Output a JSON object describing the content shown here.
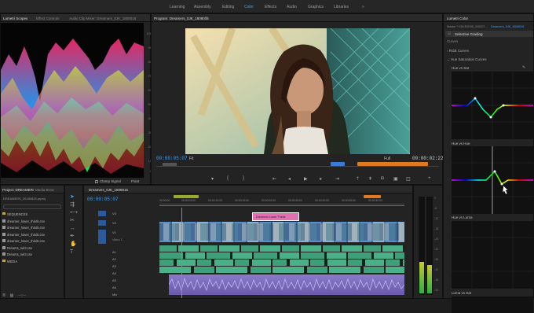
{
  "workspaces": [
    "Learning",
    "Assembly",
    "Editing",
    "Color",
    "Effects",
    "Audio",
    "Graphics",
    "Libraries"
  ],
  "workspace_active": "Color",
  "workspace_more": "»",
  "scopes_panel": {
    "tabs": [
      "Lumetri Scopes",
      "Effect Controls",
      "Audio Clip Mixer: Dreamers_0JK_1808015"
    ],
    "active": "Lumetri Scopes",
    "y_ticks": [
      "100",
      "90",
      "80",
      "70",
      "60",
      "50",
      "40",
      "30",
      "20",
      "10",
      "0"
    ],
    "bottom_check": "Clamp Signal",
    "bottom_value": "Float"
  },
  "program_monitor": {
    "title": "Program: Dreamers_0JK_1808015",
    "timecode_left": "00:00:05:07",
    "fit": "Fit",
    "full": "Full",
    "timecode_right": "00:00:02:22",
    "marker_blue": "",
    "marker_orange": ""
  },
  "lumetri_color": {
    "title": "Lumetri Color",
    "master": "Master * KDLR2095_200027...",
    "clip": "Dreamers_0JK_1808015",
    "preset": "Selective Grading",
    "curves_label": "Curves",
    "rgb_curves": "RGB Curves",
    "hue_sat_curves": "Hue Saturation Curves",
    "curve_titles": [
      "Hue vs Sat",
      "Hue vs Hue",
      "Hue vs Luma",
      "Luma vs Sat"
    ]
  },
  "project_panel": {
    "tabs": [
      "Project: DREAMERS_PROJECT_20180825",
      "Media Brow"
    ],
    "file": "DREAMERS_20180825.prproj",
    "items": [
      "SEQUENCES",
      "dreamer_lower_thirds.csv",
      "dreamer_lower_thirds.csv",
      "dreamer_lower_thirds.csv",
      "dreamer_lower_thirds.csv",
      "Dreams_sel3.csv",
      "Dreams_sel3.csv",
      "MEDIA"
    ]
  },
  "timeline": {
    "title": "Dreamers_0JK_1808015",
    "timecode": "00:00:05:07",
    "ruler": [
      "00:00:00",
      "00:00:05:00",
      "00:00:10:00",
      "00:00:15:00",
      "00:00:20:00",
      "00:00:25:00",
      "00:00:30:00",
      "00:00:35:00",
      "00:00:40:00",
      "00:00:45:00"
    ],
    "title_clip": "Dreamers Lower Thirds",
    "tracks": [
      "V3",
      "V2",
      "V1",
      "A1",
      "A2",
      "A3",
      "A4",
      "A5",
      "A6",
      "Mix"
    ],
    "video_label": "Video 1"
  },
  "meter_labels": [
    "0",
    "-6",
    "-12",
    "-18",
    "-24",
    "-30",
    "-36",
    "-42",
    "-48",
    "-54"
  ],
  "colors": {
    "accent": "#3aa0ff",
    "video_clip": "#5a8ec8",
    "audio_clip": "#3ea07a",
    "music_clip": "#8a7acb",
    "title_clip": "#e070b0"
  }
}
